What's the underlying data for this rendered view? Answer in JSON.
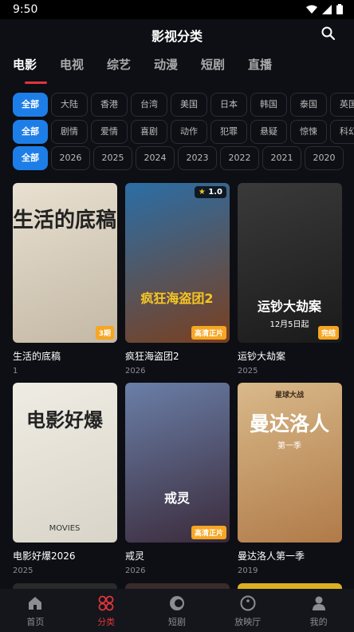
{
  "status": {
    "time": "9:50"
  },
  "header": {
    "title": "影视分类"
  },
  "tabs": [
    {
      "label": "电影",
      "active": true
    },
    {
      "label": "电视"
    },
    {
      "label": "综艺"
    },
    {
      "label": "动漫"
    },
    {
      "label": "短剧"
    },
    {
      "label": "直播"
    }
  ],
  "filters": {
    "all_label": "全部",
    "regions": [
      "大陆",
      "香港",
      "台湾",
      "美国",
      "日本",
      "韩国",
      "泰国",
      "英国"
    ],
    "genres": [
      "剧情",
      "爱情",
      "喜剧",
      "动作",
      "犯罪",
      "悬疑",
      "惊悚",
      "科幻"
    ],
    "years": [
      "2026",
      "2025",
      "2024",
      "2023",
      "2022",
      "2021",
      "2020"
    ]
  },
  "movies": [
    {
      "title": "生活的底稿",
      "sub": "1",
      "badge": "3期",
      "poster_text": "生活的底稿",
      "colors": [
        "#e8e0d0",
        "#c4b8a6"
      ]
    },
    {
      "title": "疯狂海盗团2",
      "sub": "2026",
      "badge": "高清正片",
      "rating": "1.0",
      "poster_text": "疯狂海盗团2",
      "colors": [
        "#2b6ea6",
        "#7a3f1f"
      ]
    },
    {
      "title": "运钞大劫案",
      "sub": "2025",
      "badge": "完结",
      "poster_text": "运钞大劫案",
      "poster_sub": "12月5日起",
      "colors": [
        "#3a3a3a",
        "#1a1a1a"
      ]
    },
    {
      "title": "电影好爆2026",
      "sub": "2025",
      "badge": "",
      "poster_text": "电影好爆",
      "poster_sub": "MOVIES",
      "colors": [
        "#efece4",
        "#d8d4c8"
      ]
    },
    {
      "title": "戒灵",
      "sub": "2026",
      "badge": "高清正片",
      "poster_text": "戒灵",
      "colors": [
        "#6a7fa8",
        "#3b2a3a"
      ]
    },
    {
      "title": "曼达洛人第一季",
      "sub": "2019",
      "badge": "",
      "poster_text": "曼达洛人",
      "poster_sub": "第一季",
      "poster_top": "星球大战",
      "colors": [
        "#d9b98a",
        "#b07a48"
      ]
    }
  ],
  "nav": [
    {
      "label": "首页",
      "icon": "home-icon"
    },
    {
      "label": "分类",
      "icon": "category-icon",
      "active": true
    },
    {
      "label": "短剧",
      "icon": "short-drama-icon"
    },
    {
      "label": "放映厅",
      "icon": "cinema-icon"
    },
    {
      "label": "我的",
      "icon": "profile-icon"
    }
  ],
  "accent": "#e0353d",
  "chip_active_color": "#1e7ee8",
  "badge_color": "#f6a623"
}
